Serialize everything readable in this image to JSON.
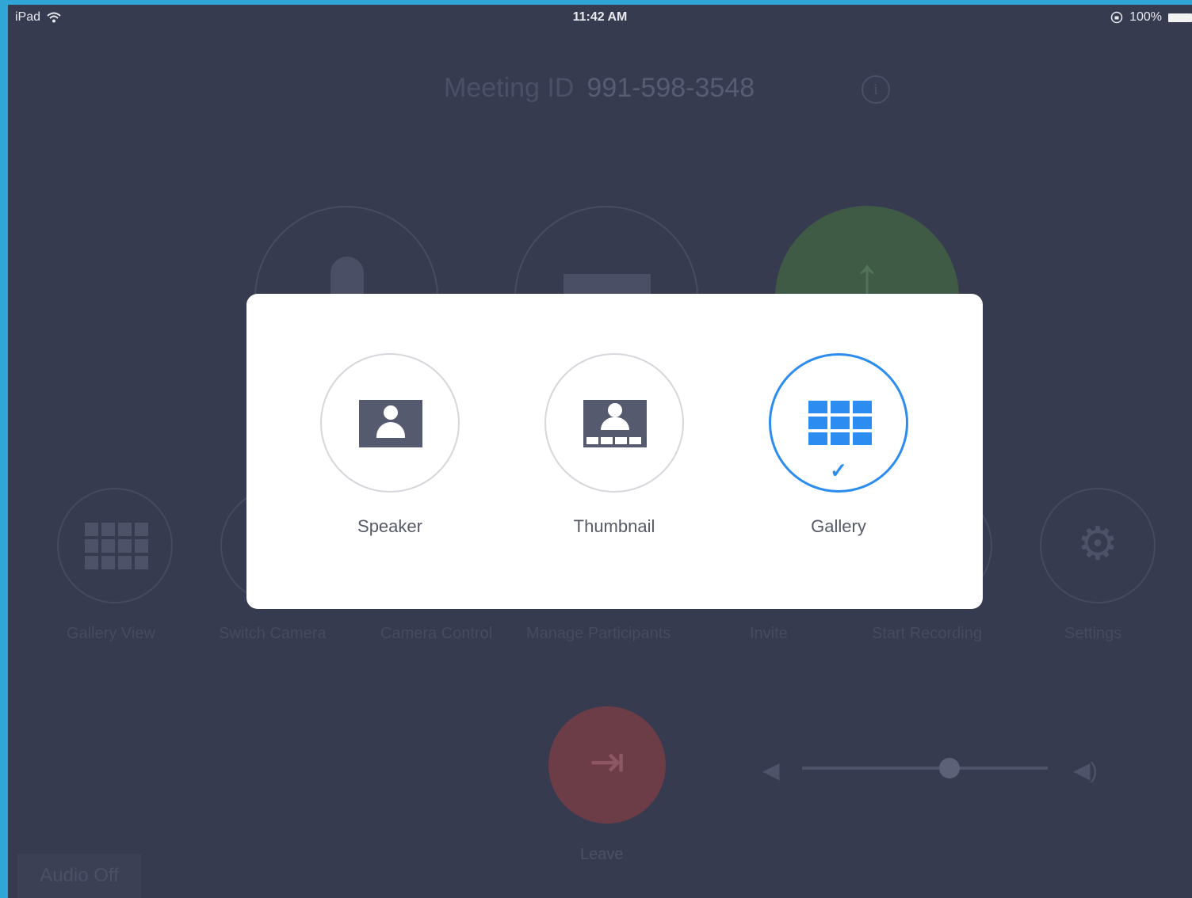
{
  "status_bar": {
    "device": "iPad",
    "time": "11:42 AM",
    "battery": "100%"
  },
  "meeting": {
    "id_label": "Meeting ID",
    "id_value": "991-598-3548"
  },
  "toolbar": {
    "items": [
      {
        "label": "Gallery View",
        "icon": "grid-icon"
      },
      {
        "label": "Switch Camera",
        "icon": "camera-switch-icon"
      },
      {
        "label": "Camera Control",
        "icon": "camera-control-icon"
      },
      {
        "label": "Manage Participants",
        "icon": "participants-icon"
      },
      {
        "label": "Invite",
        "icon": "invite-icon"
      },
      {
        "label": "Start Recording",
        "icon": "record-icon"
      },
      {
        "label": "Settings",
        "icon": "gear-icon"
      }
    ]
  },
  "leave": {
    "label": "Leave"
  },
  "volume": {
    "level": 0.6
  },
  "audio_button": {
    "label": "Audio Off"
  },
  "layout_picker": {
    "options": [
      {
        "label": "Speaker",
        "icon": "speaker-view-icon"
      },
      {
        "label": "Thumbnail",
        "icon": "thumbnail-view-icon"
      },
      {
        "label": "Gallery",
        "icon": "gallery-view-icon"
      }
    ],
    "selected": "Gallery",
    "accent": "#2d8cf0"
  }
}
